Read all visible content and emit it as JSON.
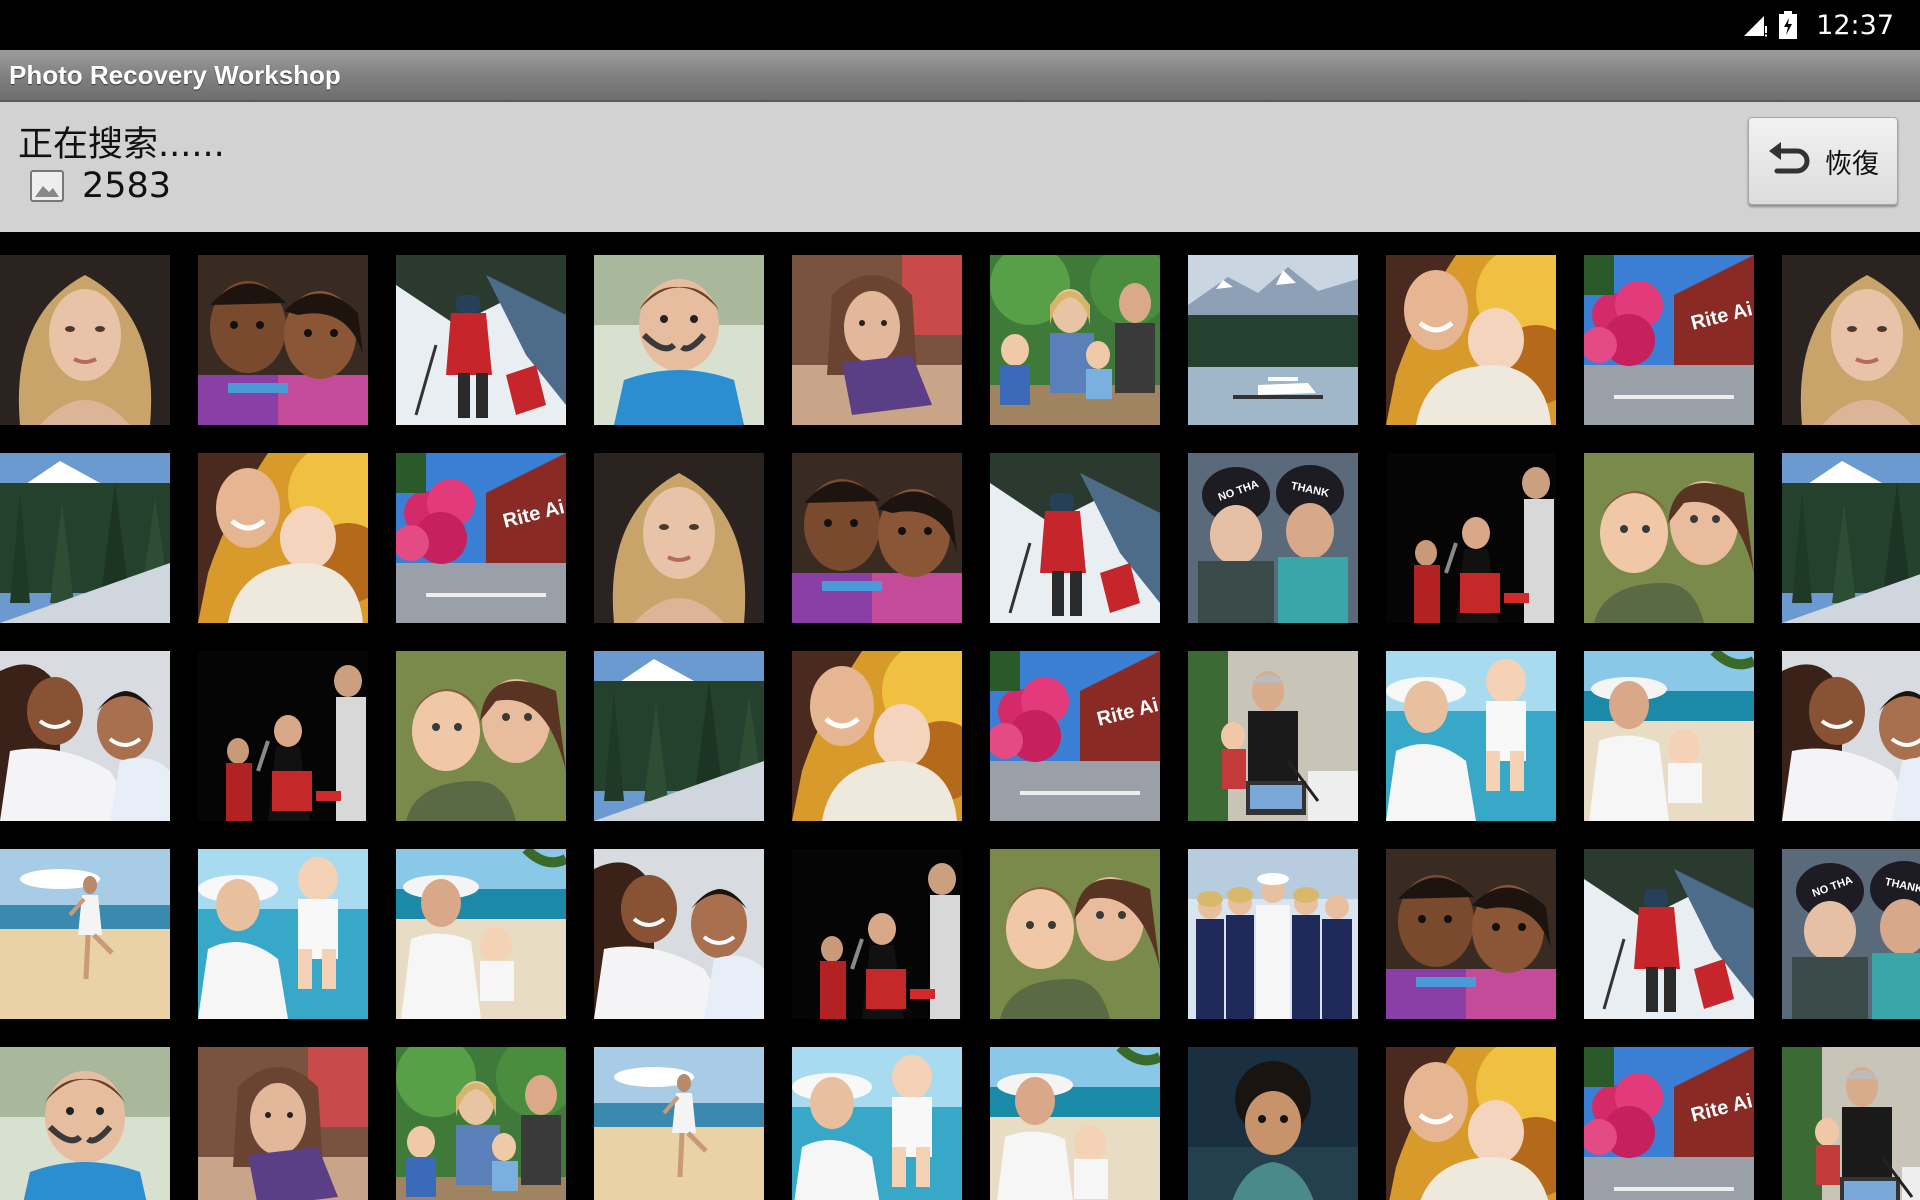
{
  "status_bar": {
    "time": "12:37"
  },
  "app": {
    "title": "Photo Recovery Workshop"
  },
  "header": {
    "status_text": "正在搜索......",
    "count": "2583",
    "restore_label": "恢復"
  },
  "grid": {
    "rows": [
      [
        "blonde-portrait",
        "two-children",
        "hiker-snow",
        "boy-face-paint",
        "teen-bedroom",
        "family-garden",
        "mountain-lake-seaplane",
        "mother-baby-autumn",
        "pink-flowers-store",
        "blonde-portrait"
      ],
      [
        "snowy-forest",
        "mother-baby-autumn",
        "pink-flowers-store",
        "blonde-portrait",
        "two-children",
        "hiker-snow",
        "girls-beanies",
        "singer-stage",
        "boy-and-girl",
        "snowy-forest"
      ],
      [
        "couple-hug",
        "singer-stage",
        "boy-and-girl",
        "snowy-forest",
        "mother-baby-autumn",
        "pink-flowers-store",
        "man-laptop-kids",
        "mother-lifting-baby",
        "beach-mother-baby",
        "couple-hug"
      ],
      [
        "beach-yoga",
        "mother-lifting-baby",
        "beach-mother-baby",
        "couple-hug",
        "singer-stage",
        "boy-and-girl",
        "sailor-women",
        "two-children",
        "hiker-snow",
        "girls-beanies"
      ],
      [
        "boy-face-paint",
        "teen-bedroom",
        "family-garden",
        "beach-yoga",
        "mother-lifting-baby",
        "beach-mother-baby",
        "curly-toddler",
        "mother-baby-autumn",
        "pink-flowers-store",
        "man-laptop-kids"
      ]
    ]
  }
}
